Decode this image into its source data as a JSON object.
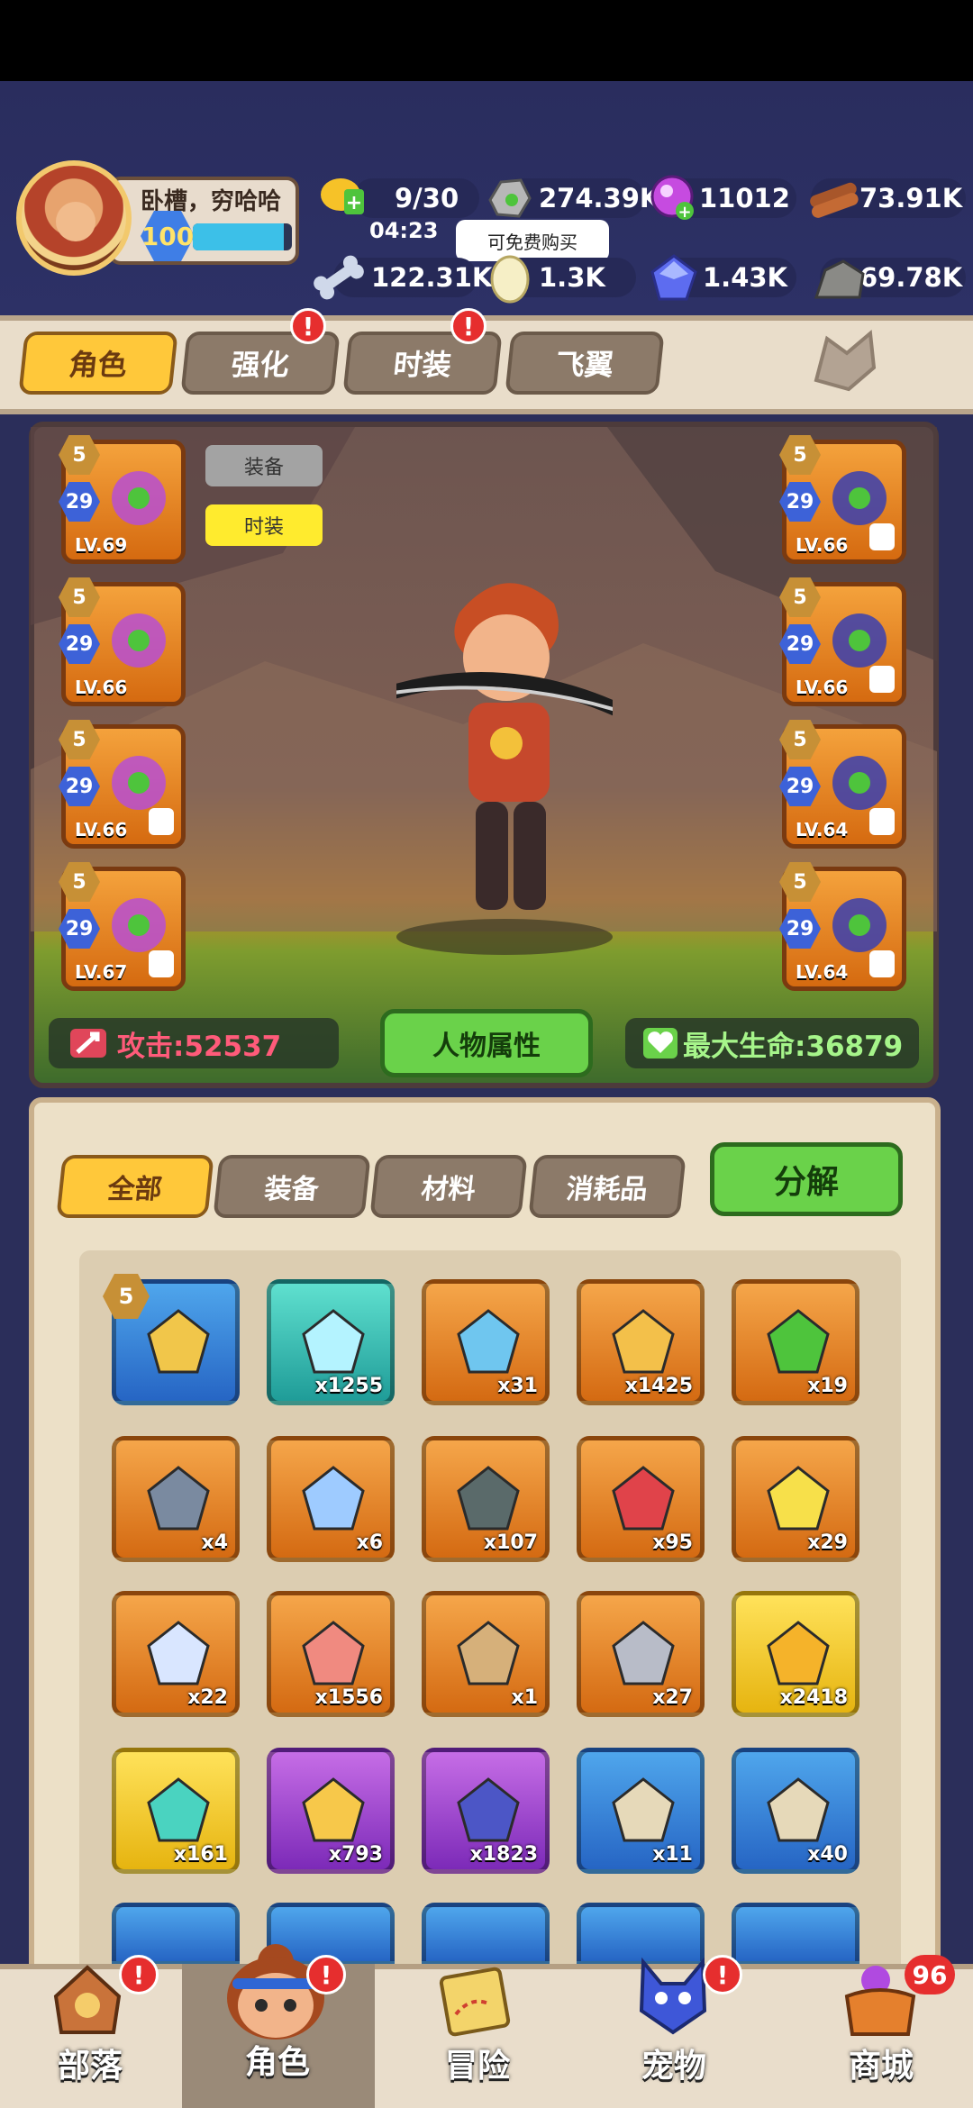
{
  "profile": {
    "name": "卧槽，穷哈哈",
    "level": "100",
    "xp_fraction": 0.92
  },
  "resources": {
    "stamina": "9/30",
    "stamina_timer": "04:23",
    "stone": "274.39K",
    "gem": "11012",
    "wood": "73.91K",
    "bone": "122.31K",
    "egg": "1.3K",
    "crystal": "1.43K",
    "ore": "69.78K",
    "tooltip": "可免费购买"
  },
  "tabs": [
    {
      "label": "角色"
    },
    {
      "label": "强化"
    },
    {
      "label": "时装"
    },
    {
      "label": "飞翼"
    }
  ],
  "badge_mark": "!",
  "character": {
    "equip_btn": "装备",
    "fashion_btn": "时装",
    "attack": "攻击:52537",
    "attr_btn": "人物属性",
    "max_hp": "最大生命:36879",
    "left_slots": [
      {
        "star": "5",
        "grade": "29",
        "level": "LV.69"
      },
      {
        "star": "5",
        "grade": "29",
        "level": "LV.66"
      },
      {
        "star": "5",
        "grade": "29",
        "level": "LV.66"
      },
      {
        "star": "5",
        "grade": "29",
        "level": "LV.67"
      }
    ],
    "right_slots": [
      {
        "star": "5",
        "grade": "29",
        "level": "LV.66"
      },
      {
        "star": "5",
        "grade": "29",
        "level": "LV.66"
      },
      {
        "star": "5",
        "grade": "29",
        "level": "LV.64"
      },
      {
        "star": "5",
        "grade": "29",
        "level": "LV.64"
      }
    ]
  },
  "inventory": {
    "filters": [
      "全部",
      "装备",
      "材料",
      "消耗品"
    ],
    "decompose": "分解",
    "first_item_star": "5",
    "items": [
      {
        "count": "",
        "rarity": "blue",
        "icon": "necklace-icon"
      },
      {
        "count": "x1255",
        "rarity": "teal",
        "icon": "crystal-icon"
      },
      {
        "count": "x31",
        "rarity": "orange",
        "icon": "scepter-icon"
      },
      {
        "count": "x1425",
        "rarity": "orange",
        "icon": "potion-icon"
      },
      {
        "count": "x19",
        "rarity": "orange",
        "icon": "flask-icon"
      },
      {
        "count": "x4",
        "rarity": "orange",
        "icon": "pickaxe-icon"
      },
      {
        "count": "x6",
        "rarity": "orange",
        "icon": "shard-icon"
      },
      {
        "count": "x107",
        "rarity": "orange",
        "icon": "rune-stone-icon"
      },
      {
        "count": "x95",
        "rarity": "orange",
        "icon": "red-crystal-icon"
      },
      {
        "count": "x29",
        "rarity": "orange",
        "icon": "emblem-icon"
      },
      {
        "count": "x22",
        "rarity": "orange",
        "icon": "diamond-icon"
      },
      {
        "count": "x1556",
        "rarity": "orange",
        "icon": "tube-icon"
      },
      {
        "count": "x1",
        "rarity": "orange",
        "icon": "scroll-tablet-icon"
      },
      {
        "count": "x27",
        "rarity": "orange",
        "icon": "iron-ingot-icon"
      },
      {
        "count": "x2418",
        "rarity": "yellow",
        "icon": "gold-pile-icon"
      },
      {
        "count": "x161",
        "rarity": "yellow",
        "icon": "glow-rune-icon"
      },
      {
        "count": "x793",
        "rarity": "purple",
        "icon": "gold-ore-icon"
      },
      {
        "count": "x1823",
        "rarity": "purple",
        "icon": "cloth-icon"
      },
      {
        "count": "x11",
        "rarity": "blue",
        "icon": "map-scroll-icon"
      },
      {
        "count": "x40",
        "rarity": "blue",
        "icon": "map-scroll-icon"
      }
    ]
  },
  "nav": {
    "items": [
      {
        "label": "部落"
      },
      {
        "label": "角色"
      },
      {
        "label": "冒险"
      },
      {
        "label": "宠物"
      },
      {
        "label": "商城"
      }
    ],
    "shop_count": "96"
  },
  "colors": {
    "accent_yellow": "#ffc83a",
    "action_green": "#6ad24a",
    "alert_red": "#e62e2e",
    "background": "#2b2e5a"
  }
}
